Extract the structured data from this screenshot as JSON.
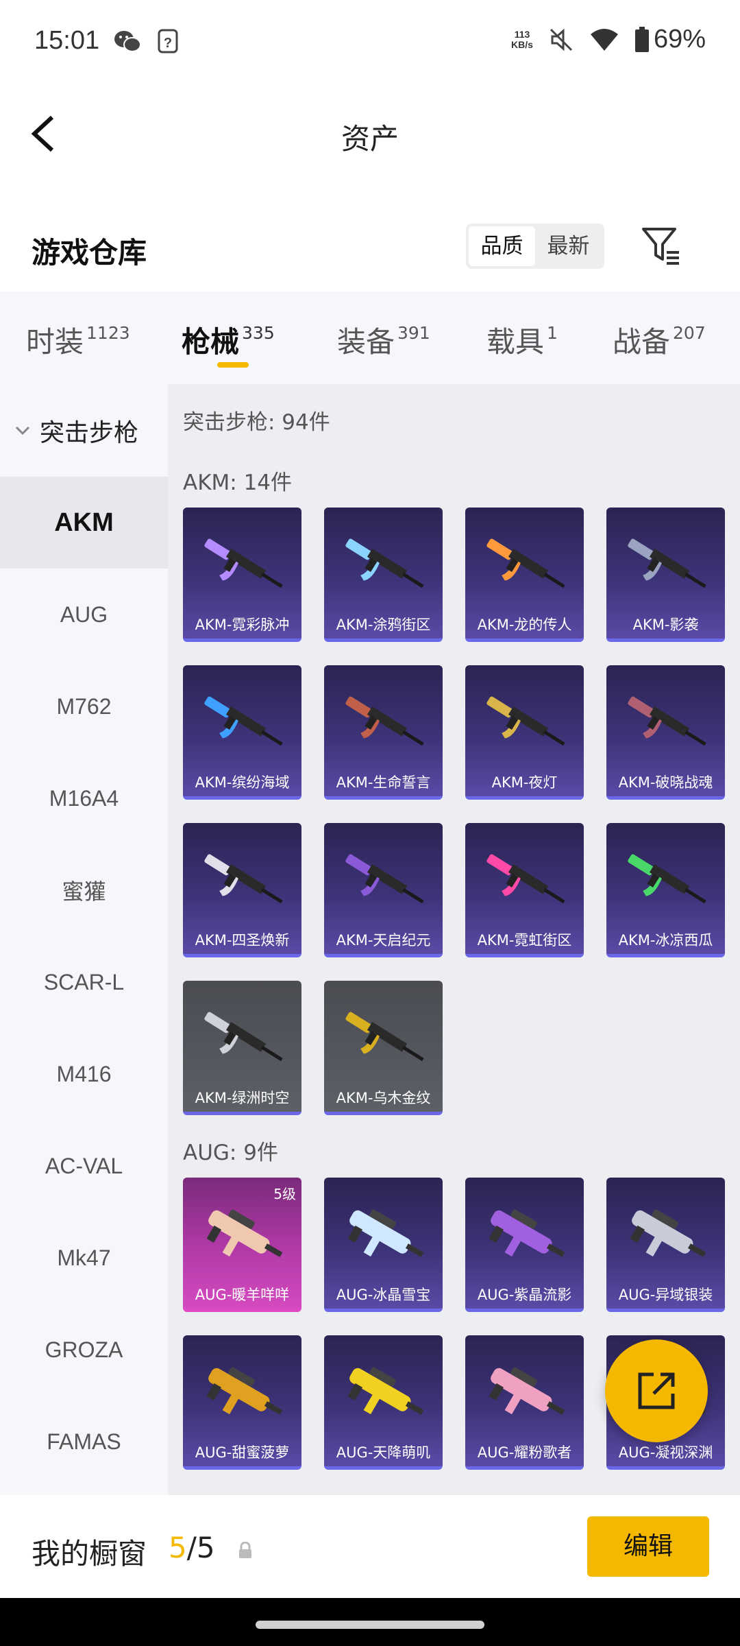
{
  "status_bar": {
    "time": "15:01",
    "net_speed_value": "113",
    "net_speed_unit": "KB/s",
    "battery": "69%",
    "icons": [
      "wechat-icon",
      "unknown-app-icon",
      "mute-icon",
      "wifi-icon",
      "battery-icon"
    ]
  },
  "header": {
    "title": "资产"
  },
  "warehouse": {
    "title": "游戏仓库",
    "sort_options": [
      "品质",
      "最新"
    ],
    "selected_sort": "品质"
  },
  "tabs": [
    {
      "label": "时装",
      "count": "1123"
    },
    {
      "label": "枪械",
      "count": "335"
    },
    {
      "label": "装备",
      "count": "391"
    },
    {
      "label": "载具",
      "count": "1"
    },
    {
      "label": "战备",
      "count": "207"
    }
  ],
  "active_tab": "枪械",
  "sidebar": {
    "group": "突击步枪",
    "items": [
      "AKM",
      "AUG",
      "M762",
      "M16A4",
      "蜜獾",
      "SCAR-L",
      "M416",
      "AC-VAL",
      "Mk47",
      "GROZA",
      "FAMAS"
    ],
    "active": "AKM"
  },
  "content": {
    "category_header": "突击步枪: 94件",
    "sections": [
      {
        "header": "AKM: 14件",
        "items": [
          {
            "name": "AKM-霓彩脉冲",
            "style": "purple"
          },
          {
            "name": "AKM-涂鸦街区",
            "style": "purple"
          },
          {
            "name": "AKM-龙的传人",
            "style": "purple"
          },
          {
            "name": "AKM-影袭",
            "style": "purple"
          },
          {
            "name": "AKM-缤纷海域",
            "style": "purple"
          },
          {
            "name": "AKM-生命誓言",
            "style": "purple"
          },
          {
            "name": "AKM-夜灯",
            "style": "purple"
          },
          {
            "name": "AKM-破晓战魂",
            "style": "purple"
          },
          {
            "name": "AKM-四圣焕新",
            "style": "purple"
          },
          {
            "name": "AKM-天启纪元",
            "style": "purple"
          },
          {
            "name": "AKM-霓虹街区",
            "style": "purple"
          },
          {
            "name": "AKM-冰凉西瓜",
            "style": "purple"
          },
          {
            "name": "AKM-绿洲时空",
            "style": "gray"
          },
          {
            "name": "AKM-乌木金纹",
            "style": "gray"
          }
        ]
      },
      {
        "header": "AUG: 9件",
        "items": [
          {
            "name": "AUG-暖羊咩咩",
            "style": "pink",
            "level": "5级"
          },
          {
            "name": "AUG-冰晶雪宝",
            "style": "purple"
          },
          {
            "name": "AUG-紫晶流影",
            "style": "purple"
          },
          {
            "name": "AUG-异域银装",
            "style": "purple"
          },
          {
            "name": "AUG-甜蜜菠萝",
            "style": "purple"
          },
          {
            "name": "AUG-天降萌叽",
            "style": "purple"
          },
          {
            "name": "AUG-耀粉歌者",
            "style": "purple"
          },
          {
            "name": "AUG-凝视深渊",
            "style": "purple"
          }
        ]
      }
    ]
  },
  "bottom_bar": {
    "title": "我的橱窗",
    "count_current": "5",
    "count_total": "/5",
    "edit_label": "编辑"
  },
  "colors": {
    "accent": "#f5b800",
    "card_purple": "#3d3378",
    "card_gray": "#55575e",
    "card_pink": "#b23aa8",
    "card_border": "#6a68e8"
  }
}
